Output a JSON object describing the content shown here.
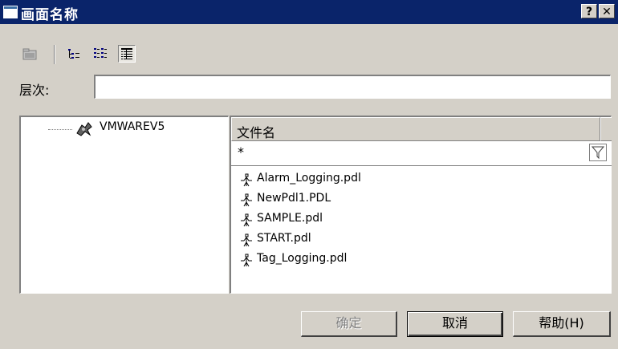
{
  "window": {
    "title": "画面名称",
    "help_button": "?",
    "close_button": "✕"
  },
  "toolbar": {
    "icons": [
      "folder-icon",
      "tree-view-icon",
      "list-view-icon",
      "details-view-icon"
    ],
    "active": "details-view-icon"
  },
  "level": {
    "label": "层次:",
    "value": ""
  },
  "tree": {
    "root_label": "VMWAREV5"
  },
  "files": {
    "column_header": "文件名",
    "filter_value": "*",
    "items": [
      "Alarm_Logging.pdl",
      "NewPdl1.PDL",
      "SAMPLE.pdl",
      "START.pdl",
      "Tag_Logging.pdl"
    ]
  },
  "buttons": {
    "ok": "确定",
    "cancel": "取消",
    "help": "帮助(H)"
  },
  "colors": {
    "titlebar": "#0a246a",
    "dialog_bg": "#d4d0c8"
  }
}
